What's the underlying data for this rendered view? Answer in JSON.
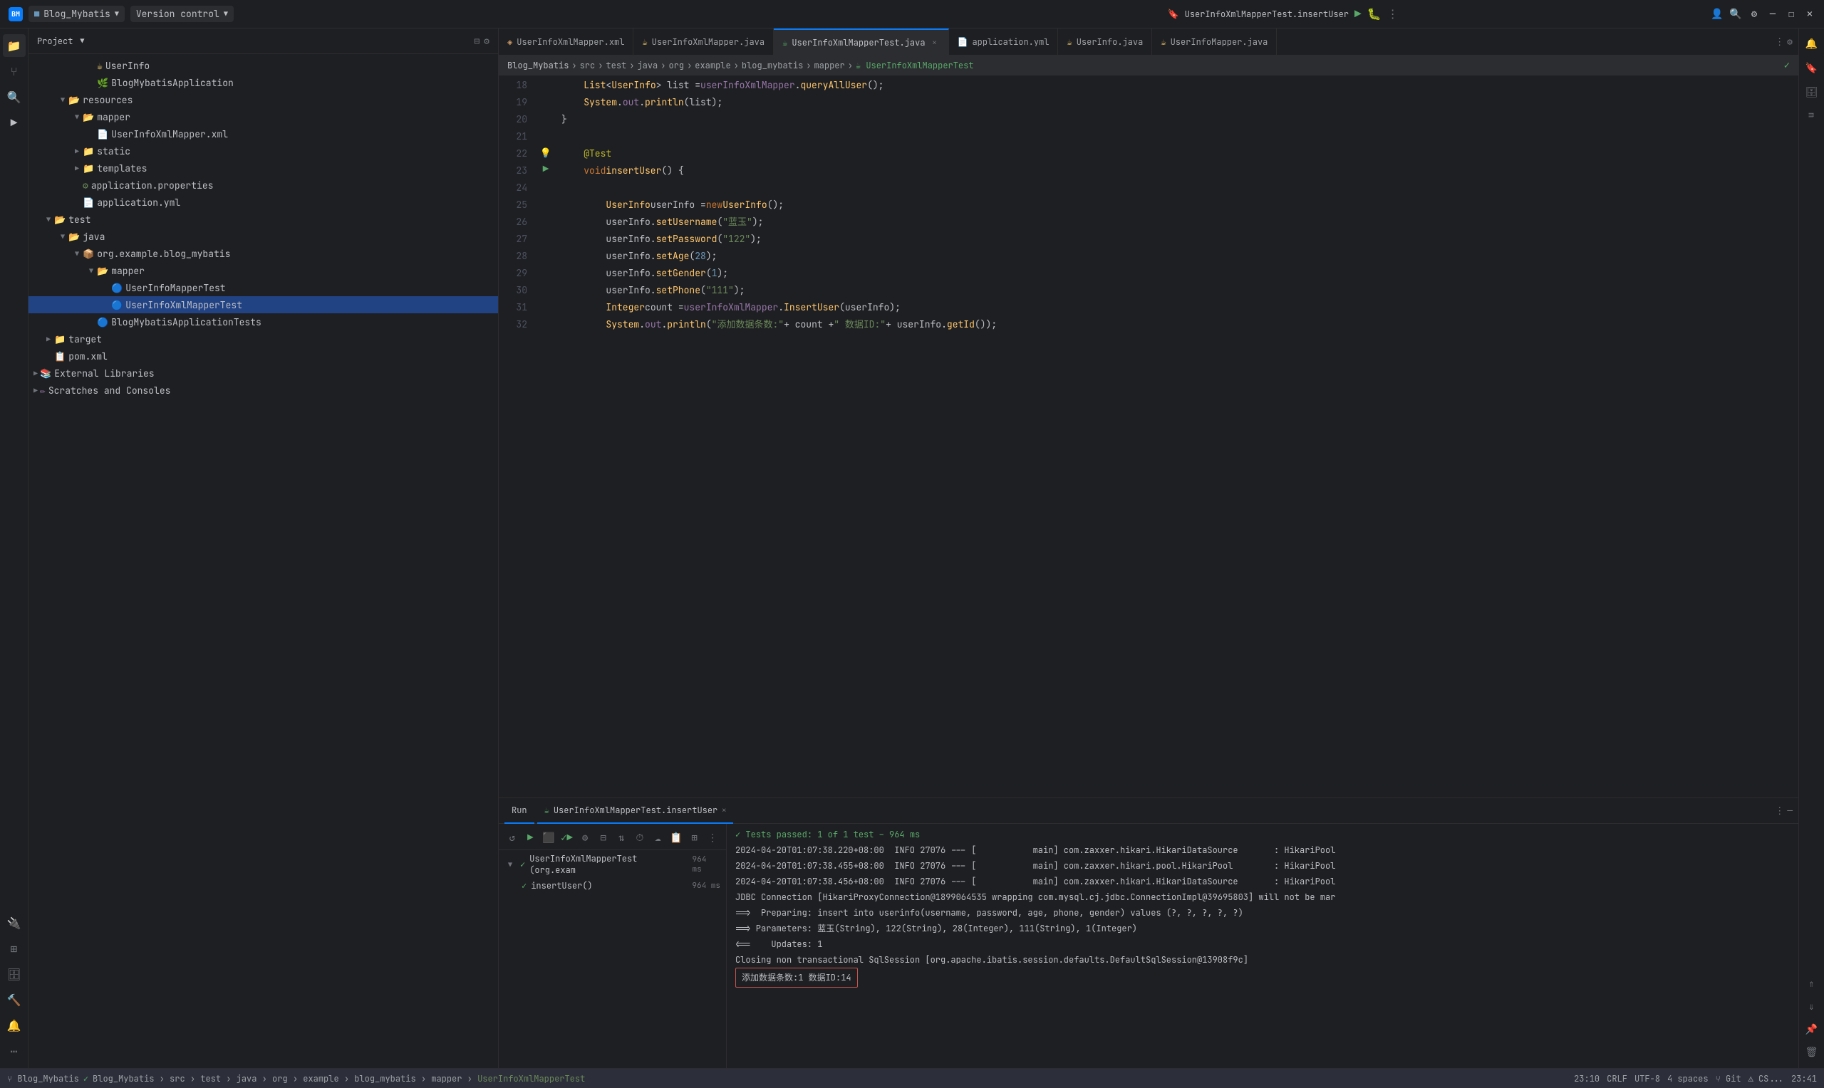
{
  "titleBar": {
    "appIcon": "BM",
    "projectName": "Blog_Mybatis",
    "vcsLabel": "Version control",
    "runTarget": "UserInfoXmlMapperTest.insertUser",
    "windowControls": {
      "minimize": "—",
      "maximize": "☐",
      "close": "✕"
    }
  },
  "tabs": [
    {
      "id": "userinfo-xml-mapper-xml",
      "label": "UserInfoXmlMapper.xml",
      "icon": "xml",
      "active": false
    },
    {
      "id": "userinfo-xml-mapper-java",
      "label": "UserInfoXmlMapper.java",
      "icon": "java",
      "active": false
    },
    {
      "id": "userinfo-xml-mapper-test-java",
      "label": "UserInfoXmlMapperTest.java",
      "icon": "test-java",
      "active": true
    },
    {
      "id": "application-yml",
      "label": "application.yml",
      "icon": "yaml",
      "active": false
    },
    {
      "id": "userinfo-java",
      "label": "UserInfo.java",
      "icon": "java",
      "active": false
    },
    {
      "id": "userinfomapper-java",
      "label": "UserInfoMapper.java",
      "icon": "java",
      "active": false
    }
  ],
  "editor": {
    "lines": [
      {
        "num": 18,
        "gutter": "",
        "code": "    List<UserInfo> list = userInfoXmlMapper.queryAllUser();"
      },
      {
        "num": 19,
        "gutter": "",
        "code": "    System.out.println(list);"
      },
      {
        "num": 20,
        "gutter": "",
        "code": "}"
      },
      {
        "num": 21,
        "gutter": "",
        "code": ""
      },
      {
        "num": 22,
        "gutter": "bulb",
        "code": "    @Test"
      },
      {
        "num": 23,
        "gutter": "run",
        "code": "    void insertUser() {"
      },
      {
        "num": 24,
        "gutter": "",
        "code": ""
      },
      {
        "num": 25,
        "gutter": "",
        "code": "        UserInfo userInfo = new UserInfo();"
      },
      {
        "num": 26,
        "gutter": "",
        "code": "        userInfo.setUsername(\"蓝玉\");"
      },
      {
        "num": 27,
        "gutter": "",
        "code": "        userInfo.setPassword(\"122\");"
      },
      {
        "num": 28,
        "gutter": "",
        "code": "        userInfo.setAge(28);"
      },
      {
        "num": 29,
        "gutter": "",
        "code": "        userInfo.setGender(1);"
      },
      {
        "num": 30,
        "gutter": "",
        "code": "        userInfo.setPhone(\"111\");"
      },
      {
        "num": 31,
        "gutter": "",
        "code": "        Integer count = userInfoXmlMapper.InsertUser(userInfo);"
      },
      {
        "num": 32,
        "gutter": "",
        "code": "        System.out.println(\"添加数据条数:\" + count + \" 数据ID:\" + userInfo.getId());"
      }
    ]
  },
  "projectTree": {
    "header": "Project",
    "items": [
      {
        "indent": 80,
        "type": "file",
        "icon": "java",
        "label": "UserInfo",
        "expanded": false
      },
      {
        "indent": 80,
        "type": "file",
        "icon": "test",
        "label": "BlogMybatisApplication",
        "expanded": false
      },
      {
        "indent": 40,
        "type": "folder",
        "icon": "folder",
        "label": "resources",
        "expanded": true,
        "arrow": "▼"
      },
      {
        "indent": 60,
        "type": "folder",
        "icon": "folder",
        "label": "mapper",
        "expanded": true,
        "arrow": "▼"
      },
      {
        "indent": 80,
        "type": "file",
        "icon": "xml",
        "label": "UserInfoXmlMapper.xml",
        "expanded": false
      },
      {
        "indent": 60,
        "type": "folder",
        "icon": "folder",
        "label": "static",
        "expanded": false,
        "arrow": "▶"
      },
      {
        "indent": 60,
        "type": "folder",
        "icon": "folder",
        "label": "templates",
        "expanded": false,
        "arrow": "▶"
      },
      {
        "indent": 60,
        "type": "file",
        "icon": "props",
        "label": "application.properties",
        "expanded": false
      },
      {
        "indent": 60,
        "type": "file",
        "icon": "yaml",
        "label": "application.yml",
        "expanded": false
      },
      {
        "indent": 20,
        "type": "folder",
        "icon": "folder",
        "label": "test",
        "expanded": true,
        "arrow": "▼"
      },
      {
        "indent": 40,
        "type": "folder",
        "icon": "folder",
        "label": "java",
        "expanded": true,
        "arrow": "▼"
      },
      {
        "indent": 60,
        "type": "folder",
        "icon": "package",
        "label": "org.example.blog_mybatis",
        "expanded": true,
        "arrow": "▼"
      },
      {
        "indent": 80,
        "type": "folder",
        "icon": "folder",
        "label": "mapper",
        "expanded": true,
        "arrow": "▼"
      },
      {
        "indent": 100,
        "type": "file",
        "icon": "test",
        "label": "UserInfoMapperTest",
        "selected": false
      },
      {
        "indent": 100,
        "type": "file",
        "icon": "test",
        "label": "UserInfoXmlMapperTest",
        "selected": true
      },
      {
        "indent": 80,
        "type": "file",
        "icon": "test",
        "label": "BlogMybatisApplicationTests",
        "selected": false
      },
      {
        "indent": 20,
        "type": "folder",
        "icon": "folder",
        "label": "target",
        "expanded": false,
        "arrow": "▶"
      },
      {
        "indent": 20,
        "type": "file",
        "icon": "pom",
        "label": "pom.xml",
        "selected": false
      },
      {
        "indent": 0,
        "type": "folder",
        "icon": "folder",
        "label": "External Libraries",
        "expanded": false,
        "arrow": "▶"
      },
      {
        "indent": 0,
        "type": "folder",
        "icon": "scratches",
        "label": "Scratches and Consoles",
        "expanded": false,
        "arrow": "▶"
      }
    ]
  },
  "runPanel": {
    "tabLabel": "Run",
    "testTabLabel": "UserInfoXmlMapperTest.insertUser",
    "toolbar": {
      "buttons": [
        "↺",
        "▶",
        "⬛",
        "▶▶",
        "↓",
        "↑",
        "⏱",
        "☁",
        "📋",
        "⊞",
        "⋮"
      ]
    },
    "testResults": {
      "suite": {
        "label": "UserInfoXmlMapperTest (org.exam",
        "time": "964 ms",
        "passed": true
      },
      "items": [
        {
          "label": "insertUser()",
          "time": "964 ms",
          "passed": true
        }
      ]
    },
    "statusLine": "✓ Tests passed: 1 of 1 test – 964 ms",
    "outputLines": [
      "2024-04-20T01:07:38.220+08:00  INFO 27076 --- [           main] com.zaxxer.hikari.HikariDataSource       : HikariPool",
      "2024-04-20T01:07:38.455+08:00  INFO 27076 --- [           main] com.zaxxer.hikari.pool.HikariPool        : HikariPool",
      "2024-04-20T01:07:38.456+08:00  INFO 27076 --- [           main] com.zaxxer.hikari.HikariDataSource       : HikariPool",
      "JDBC Connection [HikariProxyConnection@1899064535 wrapping com.mysql.cj.jdbc.ConnectionImpl@39695803] will not be mar",
      "==>  Preparing: insert into userinfo(username, password, age, phone, gender) values (?, ?, ?, ?, ?)",
      "==> Parameters: 蓝玉(String), 122(String), 28(Integer), 111(String), 1(Integer)",
      "<==    Updates: 1",
      "Closing non transactional SqlSession [org.apache.ibatis.session.defaults.DefaultSqlSession@13908f9c]"
    ],
    "highlightedOutput": "添加数据条数:1 数据ID:14"
  },
  "breadcrumb": {
    "parts": [
      "Blog_Mybatis",
      "src",
      "test",
      "java",
      "org",
      "example",
      "blog_mybatis",
      "mapper",
      "UserInfoXmlMapperTest"
    ]
  },
  "statusBar": {
    "gitBranch": "Blog_Mybatis",
    "lineCol": "23:10",
    "crlf": "CRLF",
    "encoding": "UTF-8",
    "indent": "4 spaces",
    "rightItems": [
      "CRLF",
      "UTF-8",
      "Git"
    ]
  }
}
